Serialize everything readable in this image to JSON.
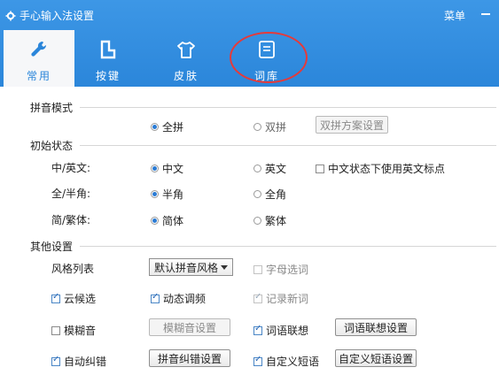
{
  "window": {
    "title": "手心输入法设置",
    "menu_label": "菜单"
  },
  "tabs": [
    {
      "label": "常用",
      "icon": "wrench-icon",
      "active": true
    },
    {
      "label": "按键",
      "icon": "keyboard-icon",
      "active": false
    },
    {
      "label": "皮肤",
      "icon": "shirt-icon",
      "active": false
    },
    {
      "label": "词库",
      "icon": "dictionary-icon",
      "active": false
    }
  ],
  "pinyin_mode": {
    "section": "拼音模式",
    "full": "全拼",
    "double": "双拼",
    "double_settings_button": "双拼方案设置",
    "selected": "全拼"
  },
  "initial_state": {
    "section": "初始状态",
    "cn_en": {
      "label": "中/英文:",
      "opt1": "中文",
      "opt2": "英文",
      "selected": "中文",
      "extra_check": "中文状态下使用英文标点",
      "extra_checked": false
    },
    "width": {
      "label": "全/半角:",
      "opt1": "半角",
      "opt2": "全角",
      "selected": "半角"
    },
    "script": {
      "label": "简/繁体:",
      "opt1": "简体",
      "opt2": "繁体",
      "selected": "简体"
    }
  },
  "other": {
    "section": "其他设置",
    "style_label": "风格列表",
    "style_value": "默认拼音风格",
    "letter_select": "字母选词",
    "cloud": "云候选",
    "dynamic_freq": "动态调频",
    "record_new": "记录新词",
    "fuzzy": "模糊音",
    "fuzzy_button": "模糊音设置",
    "word_assoc": "词语联想",
    "word_assoc_button": "词语联想设置",
    "auto_correct": "自动纠错",
    "correct_button": "拼音纠错设置",
    "custom_phrase": "自定义短语",
    "custom_phrase_button": "自定义短语设置"
  }
}
